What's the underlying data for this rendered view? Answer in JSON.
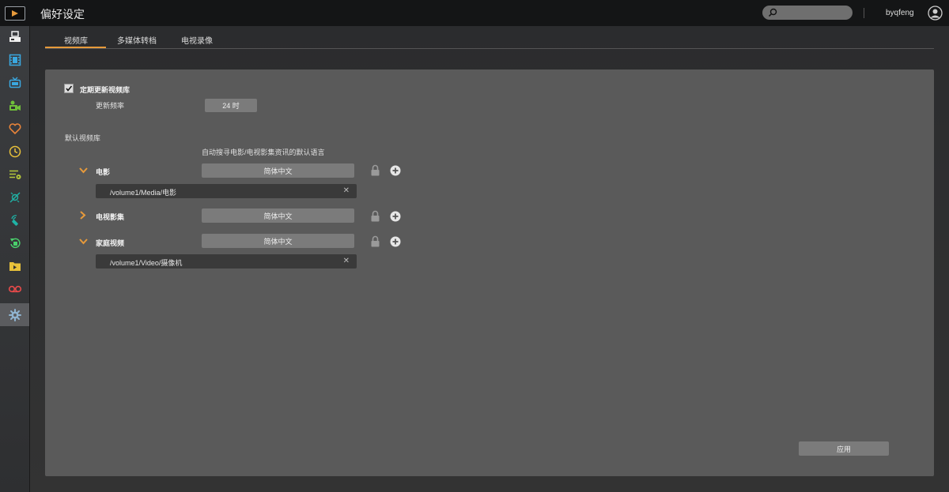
{
  "header": {
    "title": "偏好设定",
    "username": "byqfeng"
  },
  "sidebar": {
    "items": [
      {
        "icon": "server-icon",
        "color": "#f0f0f0"
      },
      {
        "icon": "film-icon",
        "color": "#3aa8e0"
      },
      {
        "icon": "tv-icon",
        "color": "#3aa8e0"
      },
      {
        "icon": "camcorder-icon",
        "color": "#6fbf3a"
      },
      {
        "icon": "heart-icon",
        "color": "#e8843a"
      },
      {
        "icon": "clock-icon",
        "color": "#e8c13a"
      },
      {
        "icon": "playlist-icon",
        "color": "#b5c93a"
      },
      {
        "icon": "dlna-icon",
        "color": "#1fb3a6"
      },
      {
        "icon": "remote-icon",
        "color": "#1fb3a6"
      },
      {
        "icon": "convert-icon",
        "color": "#4ad06c"
      },
      {
        "icon": "folder-icon",
        "color": "#e8c13a"
      },
      {
        "icon": "voicemail-icon",
        "color": "#e84a4a"
      },
      {
        "icon": "gear-icon",
        "color": "#8fb3d0"
      }
    ]
  },
  "tabs": [
    {
      "label": "视频库"
    },
    {
      "label": "多媒体转档"
    },
    {
      "label": "电视录像"
    }
  ],
  "library": {
    "auto_update_label": "定期更新视频库",
    "auto_update_checked": true,
    "frequency_label": "更新频率",
    "frequency_value": "24 时",
    "default_library_label": "默认视频库",
    "language_hint": "自动搜寻电影/电视影集资讯的默认语言",
    "categories": [
      {
        "name": "电影",
        "expanded": true,
        "language": "简体中文",
        "path": "/volume1/Media/电影"
      },
      {
        "name": "电视影集",
        "expanded": false,
        "language": "简体中文"
      },
      {
        "name": "家庭视频",
        "expanded": true,
        "language": "简体中文",
        "path": "/volume1/Video/摄像机"
      }
    ]
  },
  "apply_label": "应用",
  "colors": {
    "accent": "#e79a3b"
  }
}
